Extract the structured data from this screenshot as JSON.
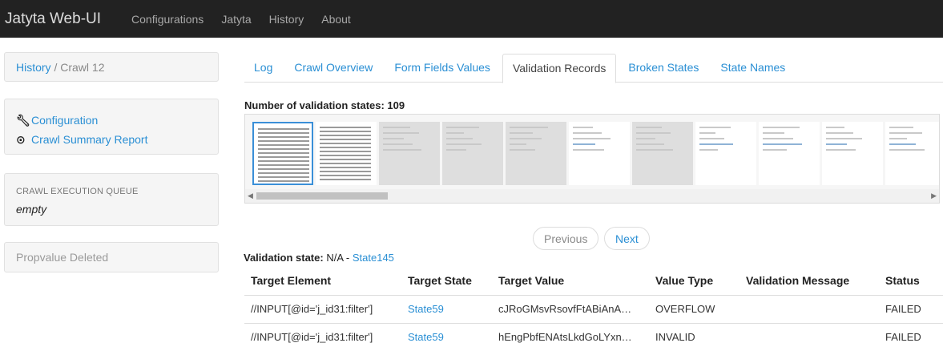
{
  "navbar": {
    "brand": "Jatyta Web-UI",
    "items": [
      "Configurations",
      "Jatyta",
      "History",
      "About"
    ]
  },
  "sidebar": {
    "breadcrumb": {
      "root": "History",
      "separator": "/",
      "current": "Crawl 12"
    },
    "links": [
      {
        "icon": "wrench-icon",
        "label": "Configuration"
      },
      {
        "icon": "report-icon",
        "label": "Crawl Summary Report"
      }
    ],
    "queue": {
      "heading": "CRAWL EXECUTION QUEUE",
      "value": "empty"
    },
    "alert": "Propvalue Deleted"
  },
  "tabs": [
    {
      "label": "Log",
      "active": false
    },
    {
      "label": "Crawl Overview",
      "active": false
    },
    {
      "label": "Form Fields Values",
      "active": false
    },
    {
      "label": "Validation Records",
      "active": true
    },
    {
      "label": "Broken States",
      "active": false
    },
    {
      "label": "State Names",
      "active": false
    }
  ],
  "validation": {
    "count_label": "Number of validation states: 109",
    "pager": {
      "previous": "Previous",
      "next": "Next"
    },
    "state_label": "Validation state:",
    "state_value": "N/A -",
    "state_link": "State145"
  },
  "table": {
    "headers": [
      "Target Element",
      "Target State",
      "Target Value",
      "Value Type",
      "Validation Message",
      "Status"
    ],
    "rows": [
      [
        "//INPUT[@id='j_id31:filter']",
        "State59",
        "cJRoGMsvRsovfFtABiAnA…",
        "OVERFLOW",
        "",
        "FAILED"
      ],
      [
        "//INPUT[@id='j_id31:filter']",
        "State59",
        "hEngPbfENAtsLkdGoLYxn…",
        "INVALID",
        "",
        "FAILED"
      ]
    ]
  },
  "colors": {
    "navbar": "#222222",
    "link": "#2a8fd4",
    "selected_thumb": "#3a8fd8"
  }
}
